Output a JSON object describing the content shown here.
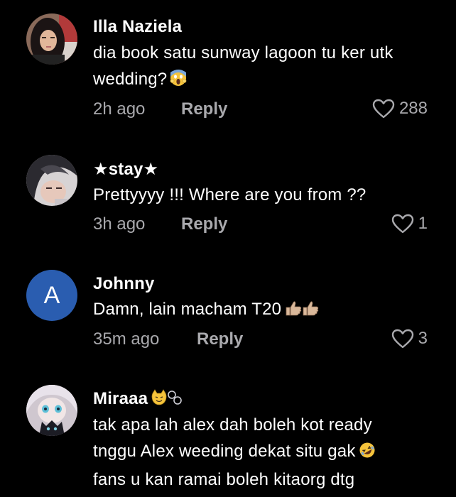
{
  "colors": {
    "background": "#000000",
    "primary_text": "#ffffff",
    "secondary_text": "#a9a9ad",
    "avatar_letter_bg": "#2a5db0"
  },
  "comments": [
    {
      "username": "Illa Naziela",
      "lines": [
        "dia book satu sunway lagoon tu ker utk",
        "wedding?"
      ],
      "emoji": "face-screaming-in-fear",
      "time": "2h ago",
      "reply_label": "Reply",
      "likes": "288",
      "avatar": "photo"
    },
    {
      "username": "★stay★",
      "lines": [
        "Prettyyyy !!! Where are you from ??"
      ],
      "time": "3h ago",
      "reply_label": "Reply",
      "likes": "1",
      "avatar": "photo"
    },
    {
      "username": "Johnny",
      "lines": [
        "Damn, lain macham T20"
      ],
      "emoji": "thumbs-up-x2",
      "time": "35m ago",
      "reply_label": "Reply",
      "likes": "3",
      "avatar_letter": "A"
    },
    {
      "username": "Miraaa",
      "username_emoji": "cat-and-bubbles",
      "lines": [
        "tak apa lah alex dah boleh kot ready",
        "tnggu Alex weeding dekat situ gak",
        "fans u kan ramai boleh kitaorg dtg"
      ],
      "emoji": "rolling-on-floor-laughing",
      "avatar": "illustration"
    }
  ]
}
